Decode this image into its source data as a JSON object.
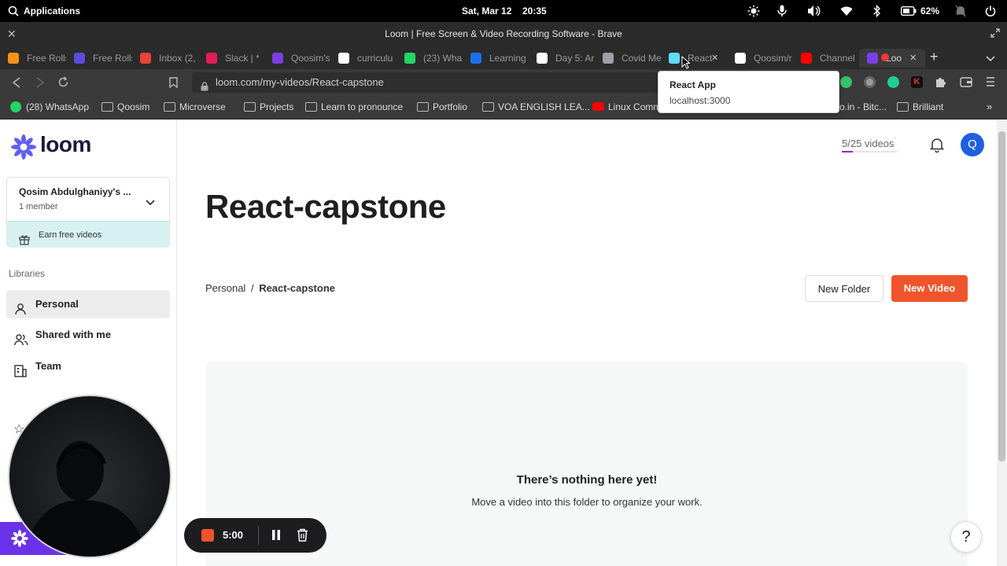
{
  "system_bar": {
    "applications": "Applications",
    "date": "Sat, Mar 12",
    "time": "20:35",
    "battery": "62%"
  },
  "window": {
    "title": "Loom | Free Screen & Video Recording Software - Brave"
  },
  "tabs": [
    {
      "label": "Free Rolls",
      "color": "#f7931a"
    },
    {
      "label": "Free Rolls",
      "color": "#5b4cdb"
    },
    {
      "label": "Inbox (2,",
      "color": "#ea4335"
    },
    {
      "label": "Slack | *",
      "color": "#e01e5a"
    },
    {
      "label": "Qoosim's",
      "color": "#7b3fe4"
    },
    {
      "label": "curriculu",
      "color": "#ffffff"
    },
    {
      "label": "(23) Wha",
      "color": "#25d366"
    },
    {
      "label": "Learning",
      "color": "#1f6feb"
    },
    {
      "label": "Day 5: Ar",
      "color": "#ffffff"
    },
    {
      "label": "Covid Me",
      "color": "#9aa0a6"
    },
    {
      "label": "React",
      "color": "#61dafb"
    },
    {
      "label": "Qoosim/r",
      "color": "#ffffff"
    },
    {
      "label": "Channel",
      "color": "#ff0000"
    },
    {
      "label": "Loo",
      "color": "#7b3fe4"
    }
  ],
  "toolbar": {
    "url": "loom.com/my-videos/React-capstone"
  },
  "bookmarks": [
    "(28) WhatsApp",
    "Qoosim",
    "Microverse",
    "Projects",
    "Learn to pronounce",
    "Portfolio",
    "VOA ENGLISH LEA...",
    "Linux Comm",
    "o.in - Bitc...",
    "Brilliant"
  ],
  "tooltip": {
    "title": "React App",
    "url": "localhost:3000"
  },
  "sidebar": {
    "logo_text": "loom",
    "workspace_name": "Qosim Abdulghaniyy's ...",
    "workspace_members": "1 member",
    "earn": "Earn free videos",
    "libraries_heading": "Libraries",
    "items": [
      {
        "label": "Personal"
      },
      {
        "label": "Shared with me"
      },
      {
        "label": "Team"
      }
    ]
  },
  "header": {
    "video_count": "5/25 videos",
    "avatar_letter": "Q",
    "video_usage_fraction": 0.2
  },
  "page": {
    "title": "React-capstone",
    "breadcrumb_root": "Personal",
    "breadcrumb_sep": "/",
    "breadcrumb_current": "React-capstone",
    "new_folder": "New Folder",
    "new_video": "New Video",
    "empty_title": "There’s nothing here yet!",
    "empty_sub": "Move a video into this folder to organize your work."
  },
  "recorder": {
    "timer": "5:00"
  },
  "help": "?",
  "colors": {
    "loom_purple": "#625df5",
    "new_video_bg": "#f1542a"
  }
}
